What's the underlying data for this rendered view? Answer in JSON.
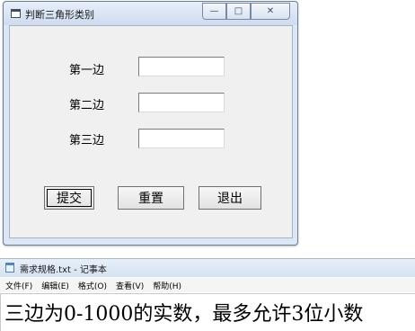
{
  "dialog": {
    "title": "判断三角形类别",
    "controls": {
      "minimize": "—",
      "maximize": "□",
      "close": "✕"
    },
    "fields": [
      {
        "label": "第一边",
        "value": ""
      },
      {
        "label": "第二边",
        "value": ""
      },
      {
        "label": "第三边",
        "value": ""
      }
    ],
    "buttons": {
      "submit": "提交",
      "reset": "重置",
      "exit": "退出"
    }
  },
  "notepad": {
    "title": "需求规格.txt - 记事本",
    "menu": [
      "文件(F)",
      "编辑(E)",
      "格式(O)",
      "查看(V)",
      "帮助(H)"
    ],
    "content": "三边为0-1000的实数，最多允许3位小数"
  }
}
